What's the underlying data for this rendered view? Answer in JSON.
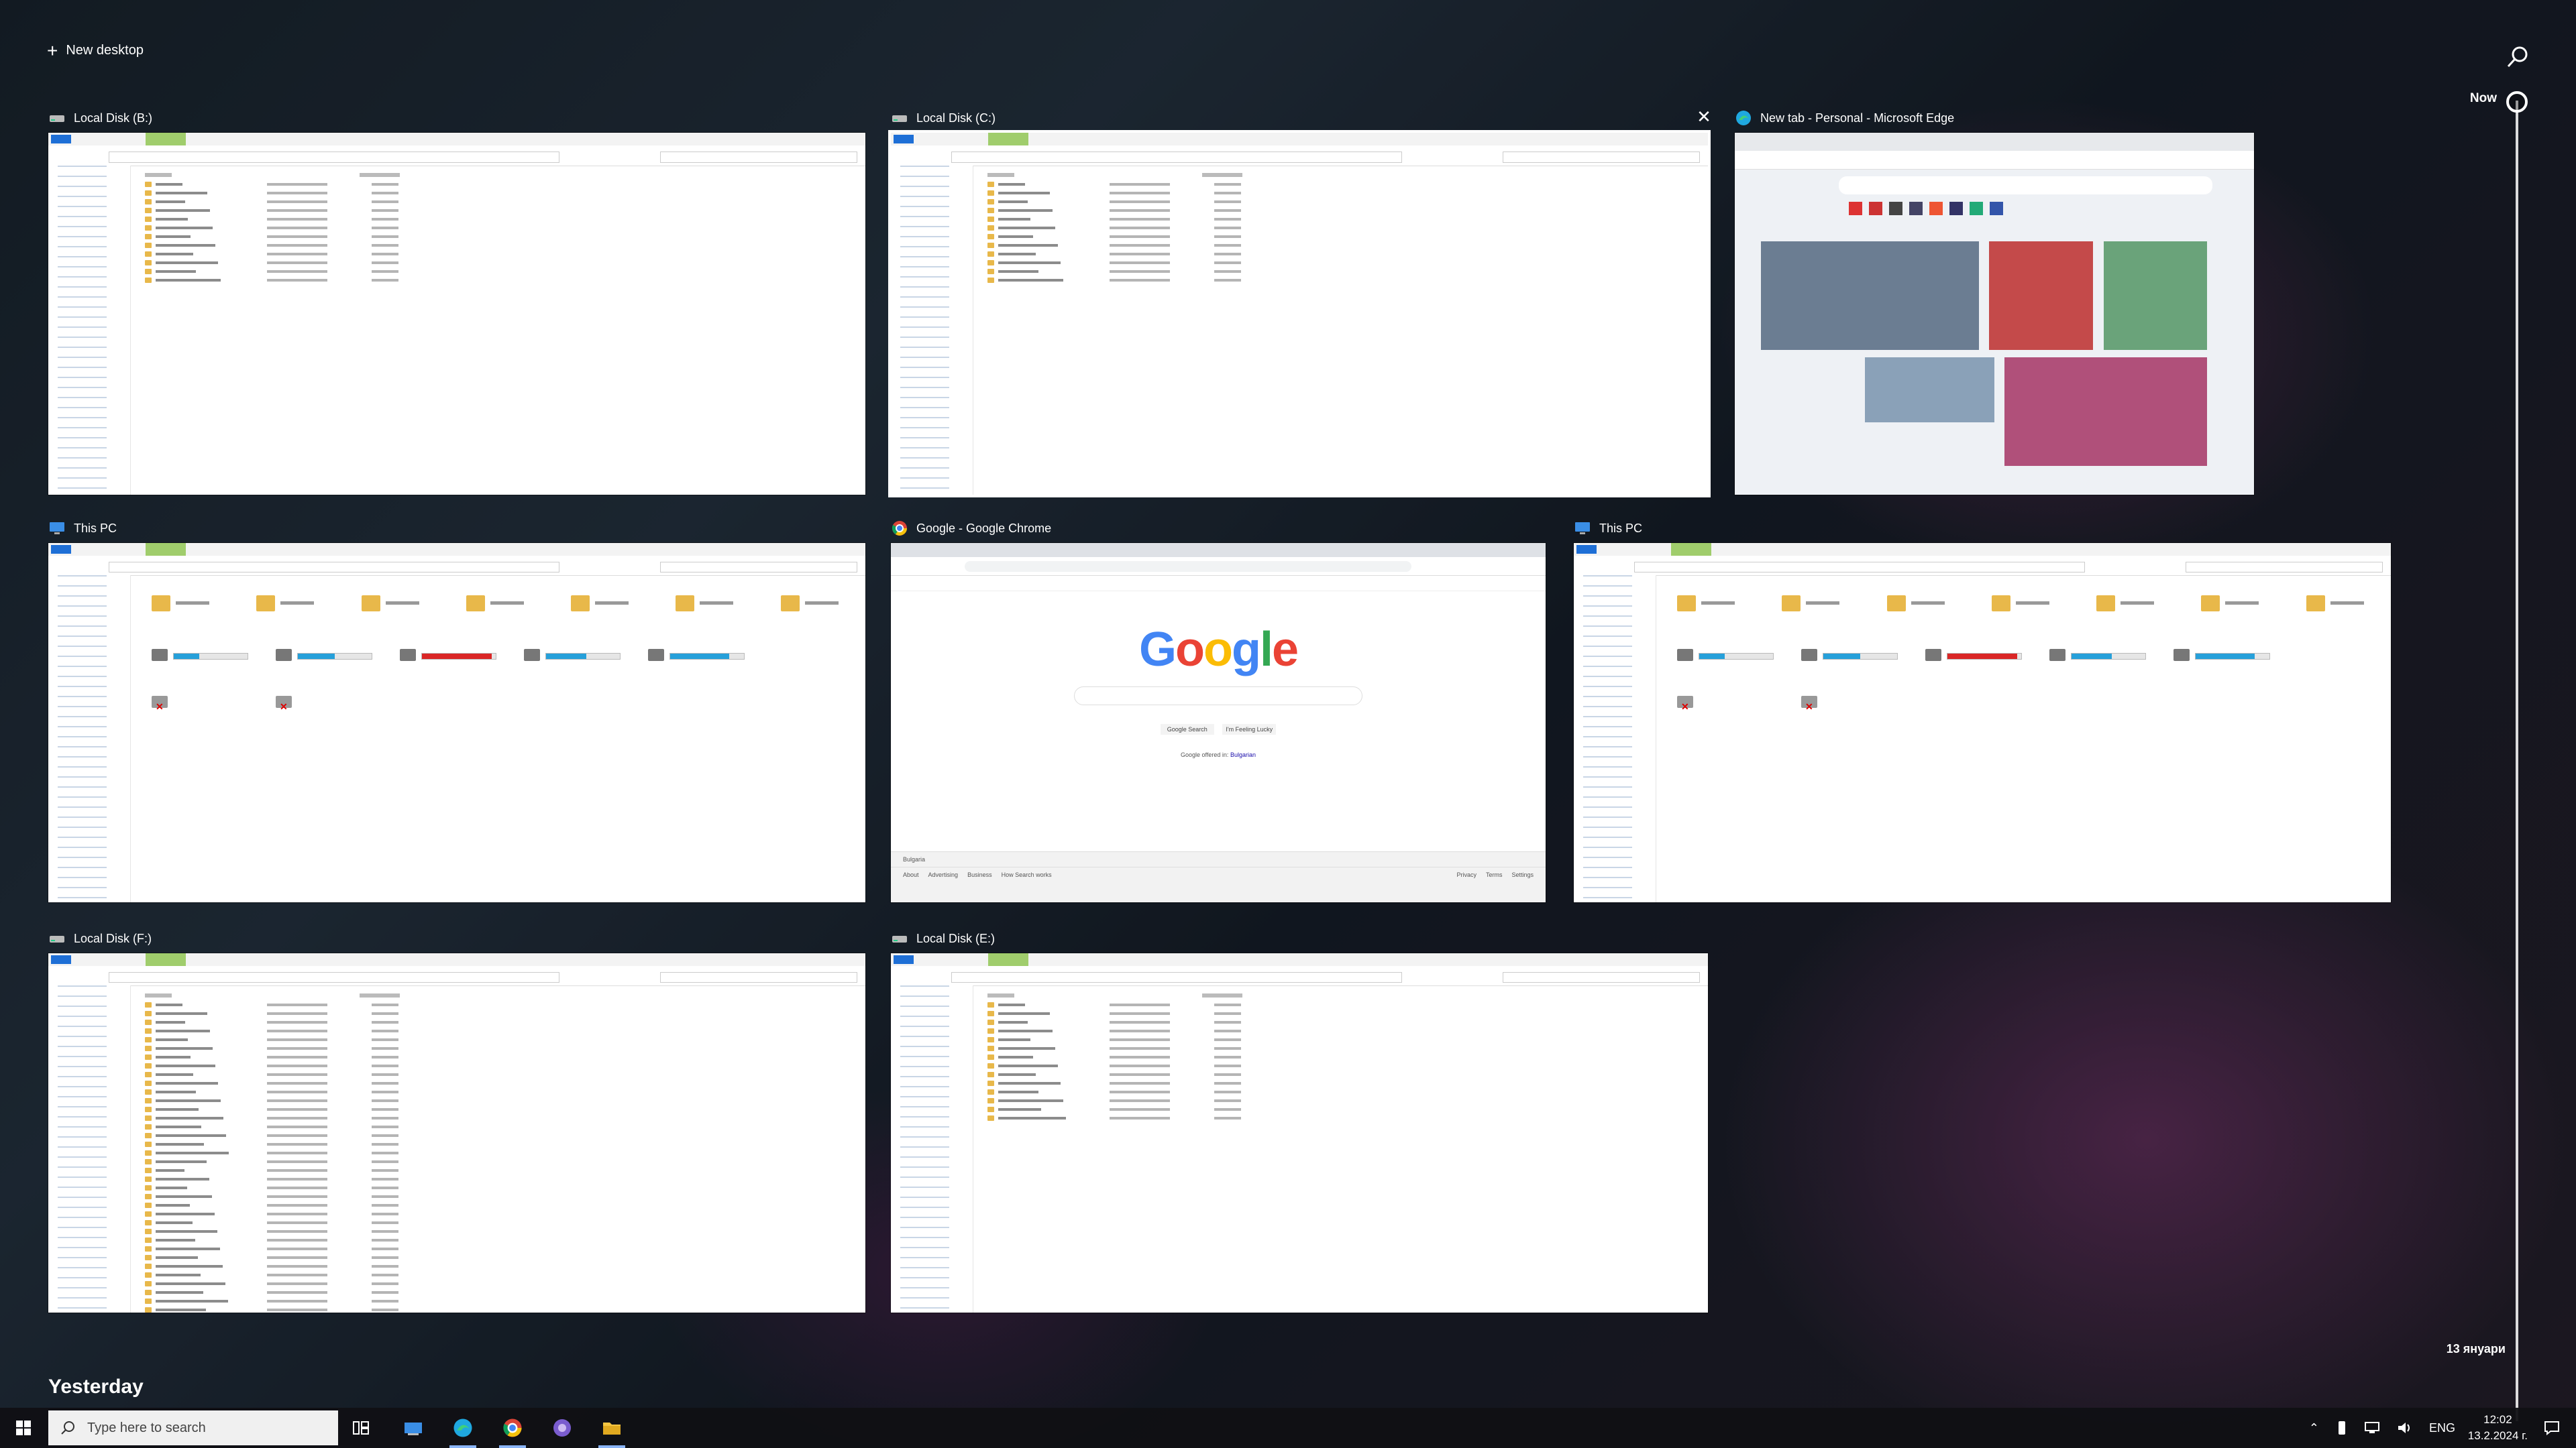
{
  "task_view": {
    "new_desktop_label": "New desktop",
    "timeline": {
      "now_label": "Now",
      "date_label": "13 януари"
    },
    "yesterday_label": "Yesterday"
  },
  "windows": [
    {
      "title": "Local Disk (B:)",
      "app": "file-explorer",
      "content": "folder-list"
    },
    {
      "title": "Local Disk (C:)",
      "app": "file-explorer",
      "content": "folder-list",
      "selected": true,
      "close_glyph": "✕"
    },
    {
      "title": "New tab - Personal - Microsoft Edge",
      "app": "edge",
      "content": "edge-newtab"
    },
    {
      "title": "This PC",
      "app": "file-explorer",
      "content": "this-pc"
    },
    {
      "title": "Google - Google Chrome",
      "app": "chrome",
      "content": "google-home",
      "google": {
        "logo": "Google",
        "search_btn": "Google Search",
        "lucky_btn": "I'm Feeling Lucky",
        "offered_in": "Google offered in:",
        "offered_lang": "Bulgarian",
        "country": "Bulgaria",
        "footer_left": [
          "About",
          "Advertising",
          "Business",
          "How Search works"
        ],
        "footer_right": [
          "Privacy",
          "Terms",
          "Settings"
        ]
      }
    },
    {
      "title": "This PC",
      "app": "file-explorer",
      "content": "this-pc"
    },
    {
      "title": "Local Disk (F:)",
      "app": "file-explorer",
      "content": "folder-list"
    },
    {
      "title": "Local Disk (E:)",
      "app": "file-explorer",
      "content": "folder-list"
    }
  ],
  "taskbar": {
    "search_placeholder": "Type here to search",
    "apps": [
      "file-explorer-pinned",
      "edge",
      "chrome",
      "mystery-app",
      "file-explorer"
    ],
    "tray": {
      "language": "ENG",
      "time": "12:02",
      "date": "13.2.2024 г."
    }
  },
  "colors": {
    "accent": "#26a0da",
    "drive_full": "#da2626",
    "folder": "#e8b84a"
  }
}
